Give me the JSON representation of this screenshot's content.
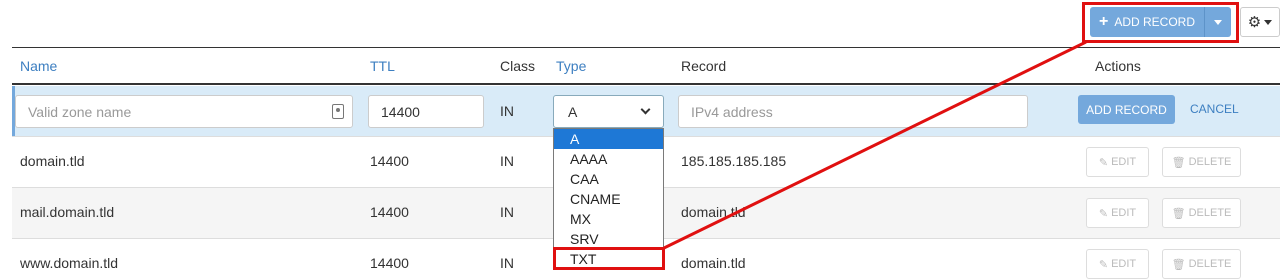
{
  "toolbar": {
    "add_record_label": "ADD RECORD",
    "plus_icon": "plus-icon",
    "settings_icon": "gear-icon"
  },
  "table": {
    "headers": {
      "name": "Name",
      "ttl": "TTL",
      "class": "Class",
      "type": "Type",
      "record": "Record",
      "actions": "Actions"
    },
    "edit_row": {
      "name_placeholder": "Valid zone name",
      "ttl_value": "14400",
      "class_value": "IN",
      "type_selected": "A",
      "record_placeholder": "IPv4 address",
      "add_label": "ADD RECORD",
      "cancel_label": "CANCEL"
    },
    "rows": [
      {
        "name": "domain.tld",
        "ttl": "14400",
        "class": "IN",
        "record": "185.185.185.185",
        "edit_label": "EDIT",
        "delete_label": "DELETE"
      },
      {
        "name": "mail.domain.tld",
        "ttl": "14400",
        "class": "IN",
        "record": "domain.tld",
        "edit_label": "EDIT",
        "delete_label": "DELETE"
      },
      {
        "name": "www.domain.tld",
        "ttl": "14400",
        "class": "IN",
        "record": "domain.tld",
        "edit_label": "EDIT",
        "delete_label": "DELETE"
      }
    ]
  },
  "type_dropdown": {
    "options": [
      "A",
      "AAAA",
      "CAA",
      "CNAME",
      "MX",
      "SRV",
      "TXT"
    ],
    "selected": "A"
  },
  "colors": {
    "accent": "#74a8dc",
    "link": "#3d7fc1",
    "highlight": "#e01010",
    "edit_row_bg": "#d9ebf8",
    "option_selected": "#1e78d6"
  }
}
